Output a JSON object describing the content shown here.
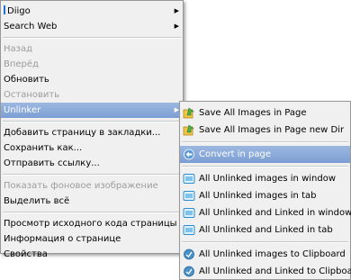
{
  "main_menu": {
    "items": [
      {
        "label": "Diigo",
        "has_submenu": true,
        "state": "normal"
      },
      {
        "label": "Search Web",
        "has_submenu": true,
        "state": "normal"
      },
      {
        "type": "separator"
      },
      {
        "label": "Назад",
        "state": "disabled"
      },
      {
        "label": "Вперёд",
        "state": "disabled"
      },
      {
        "label": "Обновить",
        "state": "normal"
      },
      {
        "label": "Остановить",
        "state": "disabled"
      },
      {
        "label": "Unlinker",
        "has_submenu": true,
        "state": "highlighted"
      },
      {
        "type": "separator"
      },
      {
        "label": "Добавить страницу в закладки...",
        "state": "normal"
      },
      {
        "label": "Сохранить как...",
        "state": "normal"
      },
      {
        "label": "Отправить ссылку...",
        "state": "normal"
      },
      {
        "type": "separator"
      },
      {
        "label": "Показать фоновое изображение",
        "state": "disabled"
      },
      {
        "label": "Выделить всё",
        "state": "normal"
      },
      {
        "type": "separator"
      },
      {
        "label": "Просмотр исходного кода страницы",
        "state": "normal"
      },
      {
        "label": "Информация о странице",
        "state": "normal"
      },
      {
        "label": "Свойства",
        "state": "normal"
      }
    ],
    "labels": {
      "diigo": "Diigo",
      "search_web": "Search Web",
      "back": "Назад",
      "forward": "Вперёд",
      "reload": "Обновить",
      "stop": "Остановить",
      "unlinker": "Unlinker",
      "bookmark": "Добавить страницу в закладки...",
      "save_as": "Сохранить как...",
      "send_link": "Отправить ссылку...",
      "show_bg": "Показать фоновое изображение",
      "select_all": "Выделить всё",
      "view_source": "Просмотр исходного кода страницы",
      "page_info": "Информация о странице",
      "properties": "Свойства"
    }
  },
  "unlinker_submenu": {
    "save_all_images": "Save All Images in Page",
    "save_all_images_dir": "Save All Images in Page new Dir",
    "convert_in_page": "Convert in page",
    "unlinked_images_window": "All Unlinked images in window",
    "unlinked_images_tab": "All Unlinked images in tab",
    "unlinked_linked_window": "All Unlinked and Linked in window",
    "unlinked_linked_tab": "All Unlinked and Linked in tab",
    "unlinked_images_clipboard": "All Unlinked images to Clipboard",
    "unlinked_linked_clipboard": "All Unlinked and Linked to Clipboard",
    "highlighted_item": "Convert in page"
  },
  "colors": {
    "highlight": "#7c9ed4",
    "menu_bg": "#f0f0f0",
    "disabled_text": "#9c9c9c"
  }
}
